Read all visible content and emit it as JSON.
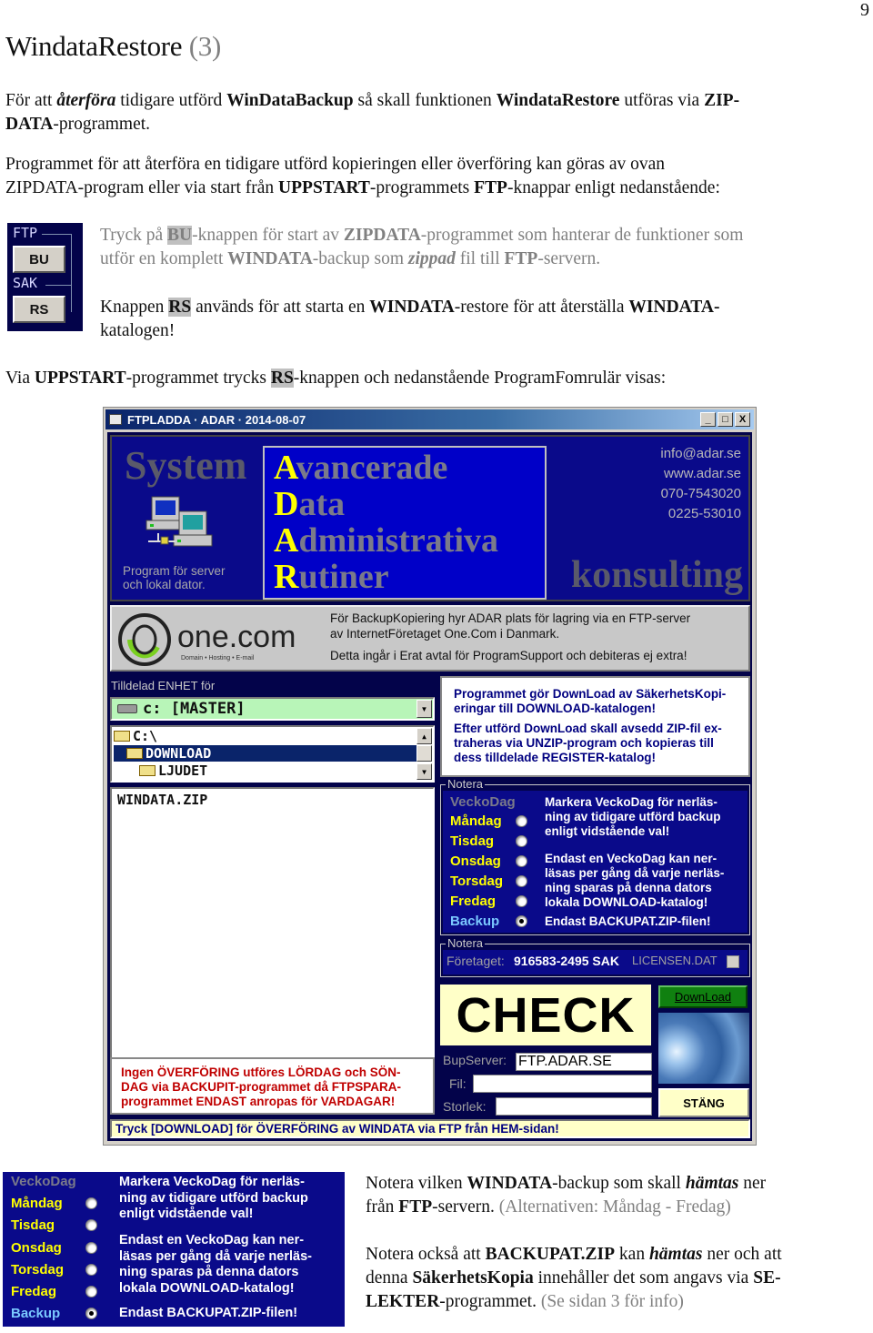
{
  "page": {
    "number": "9",
    "title": "WindataRestore",
    "title_suffix": "(3)"
  },
  "intro": {
    "p1": {
      "t1": "För att ",
      "t2": "återföra",
      "t3": " tidigare utförd ",
      "t4": "WinDataBackup",
      "t5": " så skall funktionen ",
      "t6": "WindataRestore",
      "t7": " utföras via ",
      "t8": "ZIP-",
      "t9": "DATA",
      "t10": "-programmet."
    },
    "p2": {
      "t1": "Programmet för att återföra en tidigare utförd kopieringen eller överföring kan göras av ovan",
      "t2": "ZIPDATA-program eller via start från ",
      "t3": "UPPSTART",
      "t4": "-programmets ",
      "t5": "FTP",
      "t6": "-knappar enligt nedanstående:"
    }
  },
  "ftp_panel": {
    "ftp_label": "FTP",
    "bu_button": "BU",
    "sak_label": "SAK",
    "rs_button": "RS"
  },
  "buttons_desc": {
    "bu": {
      "t1": "Tryck på ",
      "t2": "BU",
      "t3": "-knappen för start av ",
      "t4": "ZIPDATA",
      "t5": "-programmet som hanterar de funktioner som",
      "t6": "utför en komplett ",
      "t7": "WINDATA",
      "t8": "-backup som ",
      "t9": "zippad",
      "t10": " fil till ",
      "t11": "FTP",
      "t12": "-servern."
    },
    "rs": {
      "t1": "Knappen ",
      "t2": "RS",
      "t3": " används för att starta en ",
      "t4": "WINDATA",
      "t5": "-restore för att återställa ",
      "t6": "WINDATA-",
      "t7": "katalogen!"
    }
  },
  "via": {
    "t1": "Via ",
    "t2": "UPPSTART",
    "t3": "-programmet trycks ",
    "t4": "RS",
    "t5": "-knappen och nedanstående ProgramFomrulär visas:"
  },
  "app": {
    "window_title": "FTPLADDA · ADAR · 2014-08-07",
    "titlebar_buttons": {
      "minimize": "_",
      "maximize": "□",
      "close": "X"
    },
    "banner": {
      "system": "System",
      "program_note_1": "Program för server",
      "program_note_2": "och lokal dator.",
      "adar": [
        {
          "cap": "A",
          "rest": "vancerade"
        },
        {
          "cap": "D",
          "rest": "ata"
        },
        {
          "cap": "A",
          "rest": "dministrativa"
        },
        {
          "cap": "R",
          "rest": "utiner"
        }
      ],
      "email": "info@adar.se",
      "web": "www.adar.se",
      "phone1": "070-7543020",
      "phone2": "0225-53010",
      "konsulting": "konsulting"
    },
    "onecom": {
      "logo_text": "one.com",
      "logo_tagline": "Domain • Hosting • E-mail",
      "line1": "För BackupKopiering hyr ADAR plats för lagring via en FTP-server",
      "line2": "av InternetFöretaget One.Com i Danmark.",
      "line3": "Detta ingår i Erat avtal för ProgramSupport och debiteras ej extra!"
    },
    "drive_label": "Tilldelad ENHET för",
    "drive_value": "c:  [MASTER]",
    "dirs": [
      {
        "name": "C:\\",
        "selected": false
      },
      {
        "name": "DOWNLOAD",
        "selected": true
      },
      {
        "name": "LJUDET",
        "selected": false
      }
    ],
    "files": [
      "WINDATA.ZIP"
    ],
    "warning": {
      "l1": "Ingen ÖVERFÖRING utföres LÖRDAG och SÖN-",
      "l2": "DAG via BACKUPIT-programmet då FTPSPARA-",
      "l3": "programmet ENDAST anropas för VARDAGAR!"
    },
    "info": {
      "p1l1": "Programmet gör DownLoad av SäkerhetsKopi-",
      "p1l2": "eringar till DOWNLOAD-katalogen!",
      "p2l1": "Efter utförd DownLoad skall avsedd ZIP-fil ex-",
      "p2l2": "traheras via UNZIP-program och kopieras till",
      "p2l3": "dess tilldelade REGISTER-katalog!"
    },
    "notera_title": "Notera",
    "days": {
      "header": "VeckoDag",
      "items": [
        {
          "label": "Måndag",
          "selected": false
        },
        {
          "label": "Tisdag",
          "selected": false
        },
        {
          "label": "Onsdag",
          "selected": false
        },
        {
          "label": "Torsdag",
          "selected": false
        },
        {
          "label": "Fredag",
          "selected": false
        },
        {
          "label": "Backup",
          "selected": true
        }
      ],
      "note1": {
        "l1": "Markera VeckoDag för nerläs-",
        "l2": "ning av tidigare utförd backup",
        "l3": "enligt vidstående val!"
      },
      "note2": {
        "l1": "Endast en VeckoDag kan ner-",
        "l2": "läsas per gång då varje nerläs-",
        "l3": "ning sparas på denna dators",
        "l4": "lokala DOWNLOAD-katalog!"
      },
      "note3": "Endast BACKUPAT.ZIP-filen!"
    },
    "license": {
      "label": "Företaget:",
      "value": "916583-2495 SAK",
      "file": "LICENSEN.DAT",
      "checked": false
    },
    "check_label": "CHECK",
    "download_button": "DownLoad",
    "close_button": "STÄNG",
    "fields": {
      "server_label": "BupServer:",
      "server_value": "FTP.ADAR.SE",
      "file_label": "Fil:",
      "file_value": "",
      "size_label": "Storlek:",
      "size_value": ""
    },
    "status": "Tryck [DOWNLOAD] för ÖVERFÖRING av WINDATA via FTP från HEM-sidan!"
  },
  "bottom": {
    "p1": {
      "t1": "Notera vilken ",
      "t2": "WINDATA",
      "t3": "-backup som skall ",
      "t4": "hämtas",
      "t5": " ner",
      "t6": "från ",
      "t7": "FTP",
      "t8": "-servern. ",
      "t9": "(Alternativen: Måndag - Fredag)"
    },
    "p2": {
      "t1": "Notera också att ",
      "t2": "BACKUPAT.ZIP",
      "t3": " kan ",
      "t4": "hämtas",
      "t5": " ner och att",
      "t6": "denna ",
      "t7": "SäkerhetsKopia",
      "t8": " innehåller det som angavs via ",
      "t9": "SE-",
      "t10": "LEKTER",
      "t11": "-programmet. ",
      "t12": "(Se sidan 3 för info)"
    }
  }
}
